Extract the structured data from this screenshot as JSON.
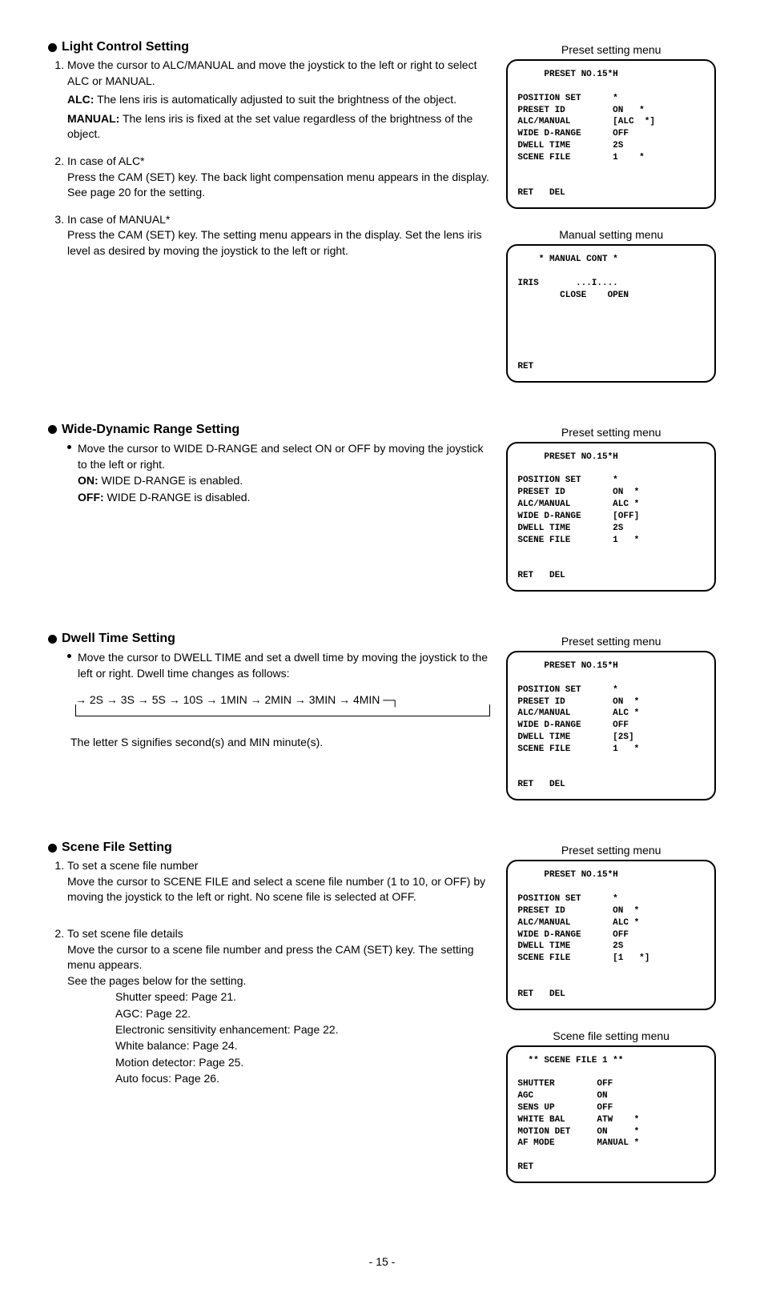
{
  "page_number": "- 15 -",
  "sections": {
    "light": {
      "heading": "Light Control Setting",
      "item1a": "Move the cursor to ALC/MANUAL and move the joystick to the left or right to select ALC or MANUAL.",
      "alc_label": "ALC:",
      "alc_text": " The lens iris is automatically adjusted to suit the brightness of the object.",
      "manual_label": "MANUAL:",
      "manual_text": " The lens iris is fixed at the set value regardless of the brightness of the object.",
      "item2_head": "In case of ALC*",
      "item2_body": "Press the CAM (SET) key. The back light compensation menu appears in the display. See page 20 for the setting.",
      "item3_head": "In case of MANUAL*",
      "item3_body": "Press the CAM (SET) key. The setting menu appears in the display. Set the lens iris level as desired by moving the joystick to the left or right.",
      "menu1_caption": "Preset setting menu",
      "menu1": "     PRESET NO.15*H\n\nPOSITION SET      *\nPRESET ID         ON   *\nALC/MANUAL        [ALC  *]\nWIDE D-RANGE      OFF\nDWELL TIME        2S\nSCENE FILE        1    *\n\n\nRET   DEL",
      "menu2_caption": "Manual setting menu",
      "menu2": "    * MANUAL CONT *\n\nIRIS       ...I....\n        CLOSE    OPEN\n\n\n\n\n\nRET"
    },
    "wide": {
      "heading": "Wide-Dynamic Range Setting",
      "body": "Move the cursor to WIDE D-RANGE and select ON or OFF by moving the joystick to the left or right.",
      "on_label": "ON:",
      "on_text": " WIDE D-RANGE is enabled.",
      "off_label": "OFF:",
      "off_text": " WIDE D-RANGE is disabled.",
      "menu_caption": "Preset setting menu",
      "menu": "     PRESET NO.15*H\n\nPOSITION SET      *\nPRESET ID         ON  *\nALC/MANUAL        ALC *\nWIDE D-RANGE      [OFF]\nDWELL TIME        2S\nSCENE FILE        1   *\n\n\nRET   DEL"
    },
    "dwell": {
      "heading": "Dwell Time Setting",
      "body": "Move the cursor to DWELL TIME and set a dwell time by moving the joystick to the left or right. Dwell time changes as follows:",
      "sequence": "→ 2S → 3S → 5S → 10S → 1MIN → 2MIN → 3MIN → 4MIN ─┐",
      "note": "The letter S signifies second(s) and MIN minute(s).",
      "menu_caption": "Preset setting menu",
      "menu": "     PRESET NO.15*H\n\nPOSITION SET      *\nPRESET ID         ON  *\nALC/MANUAL        ALC *\nWIDE D-RANGE      OFF\nDWELL TIME        [2S]\nSCENE FILE        1   *\n\n\nRET   DEL"
    },
    "scene": {
      "heading": "Scene File Setting",
      "item1_head": "To set a scene file number",
      "item1_body": "Move the cursor to SCENE FILE and select a scene file number (1 to 10, or OFF) by moving the joystick to the left or right. No scene file is selected at OFF.",
      "item2_head": "To set scene file details",
      "item2_body": "Move the cursor to a scene file number and press the CAM (SET) key. The setting menu appears.",
      "item2_see": "See the pages below for the setting.",
      "pg1": "Shutter speed: Page 21.",
      "pg2": "AGC: Page 22.",
      "pg3": "Electronic sensitivity enhancement: Page 22.",
      "pg4": "White balance: Page 24.",
      "pg5": "Motion detector: Page 25.",
      "pg6": "Auto focus: Page 26.",
      "menu1_caption": "Preset setting menu",
      "menu1": "     PRESET NO.15*H\n\nPOSITION SET      *\nPRESET ID         ON  *\nALC/MANUAL        ALC *\nWIDE D-RANGE      OFF\nDWELL TIME        2S\nSCENE FILE        [1   *]\n\n\nRET   DEL",
      "menu2_caption": "Scene file setting menu",
      "menu2": "  ** SCENE FILE 1 **\n\nSHUTTER        OFF\nAGC            ON\nSENS UP        OFF\nWHITE BAL      ATW    *\nMOTION DET     ON     *\nAF MODE        MANUAL *\n\nRET"
    }
  }
}
